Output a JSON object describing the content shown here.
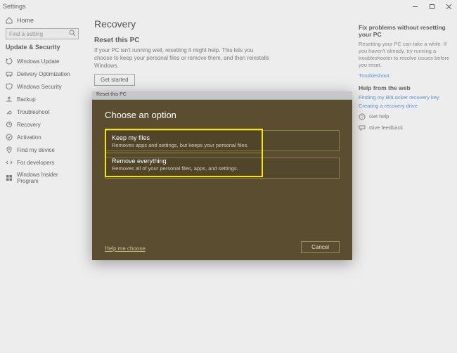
{
  "window": {
    "title": "Settings"
  },
  "sidebar": {
    "home": "Home",
    "search_placeholder": "Find a setting",
    "section": "Update & Security",
    "items": [
      {
        "icon": "sync-icon",
        "label": "Windows Update"
      },
      {
        "icon": "delivery-icon",
        "label": "Delivery Optimization"
      },
      {
        "icon": "shield-icon",
        "label": "Windows Security"
      },
      {
        "icon": "backup-icon",
        "label": "Backup"
      },
      {
        "icon": "troubleshoot-icon",
        "label": "Troubleshoot"
      },
      {
        "icon": "recovery-icon",
        "label": "Recovery"
      },
      {
        "icon": "activation-icon",
        "label": "Activation"
      },
      {
        "icon": "find-icon",
        "label": "Find my device"
      },
      {
        "icon": "dev-icon",
        "label": "For developers"
      },
      {
        "icon": "insider-icon",
        "label": "Windows Insider Program"
      }
    ]
  },
  "main": {
    "page_title": "Recovery",
    "section_title": "Reset this PC",
    "section_desc": "If your PC isn't running well, resetting it might help. This lets you choose to keep your personal files or remove them, and then reinstalls Windows.",
    "get_started": "Get started"
  },
  "rightpanel": {
    "h1": "Fix problems without resetting your PC",
    "p1": "Resetting your PC can take a while. If you haven't already, try running a troubleshooter to resolve issues before you reset.",
    "link1": "Troubleshoot",
    "h2": "Help from the web",
    "link2": "Finding my BitLocker recovery key",
    "link3": "Creating a recovery drive",
    "help": "Get help",
    "feedback": "Give feedback"
  },
  "modal": {
    "tab_label": "Reset this PC",
    "title": "Choose an option",
    "option1_title": "Keep my files",
    "option1_desc": "Removes apps and settings, but keeps your personal files.",
    "option2_title": "Remove everything",
    "option2_desc": "Removes all of your personal files, apps, and settings.",
    "help_link": "Help me choose",
    "cancel": "Cancel"
  }
}
